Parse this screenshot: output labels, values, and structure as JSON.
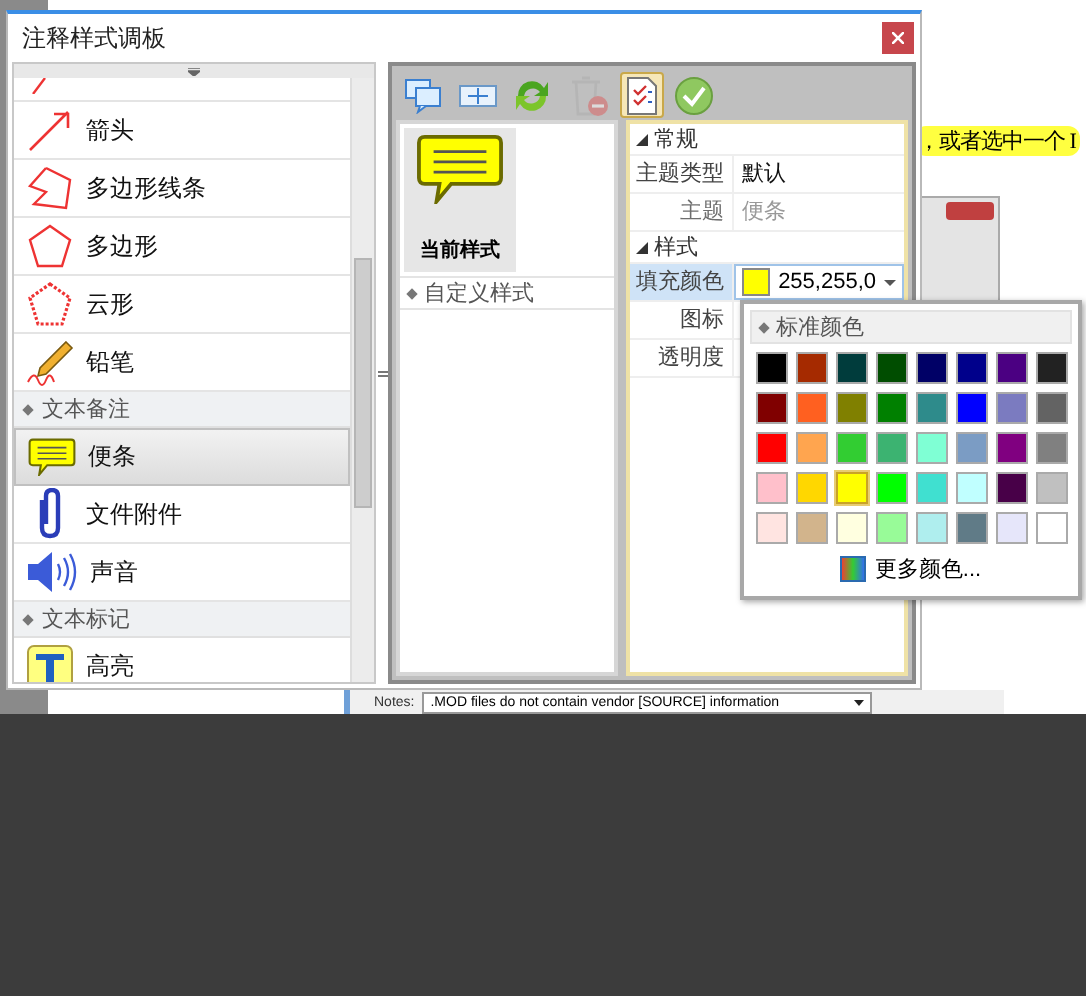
{
  "background_doc": {
    "highlight_text": "，或者选中一个 I",
    "notes_label": "Notes:",
    "notes_value": ".MOD files do not contain vendor [SOURCE] information"
  },
  "window": {
    "title": "注释样式调板"
  },
  "style_list": [
    {
      "kind": "item",
      "selected": false
    },
    {
      "kind": "item",
      "label": "箭头",
      "selected": false
    },
    {
      "kind": "item",
      "label": "多边形线条",
      "selected": false
    },
    {
      "kind": "item",
      "label": "多边形",
      "selected": false
    },
    {
      "kind": "item",
      "label": "云形",
      "selected": false
    },
    {
      "kind": "item",
      "label": "铅笔",
      "selected": false
    },
    {
      "kind": "group",
      "label": "文本备注"
    },
    {
      "kind": "item",
      "label": "便条",
      "selected": true
    },
    {
      "kind": "item",
      "label": "文件附件",
      "selected": false
    },
    {
      "kind": "item",
      "label": "声音",
      "selected": false
    },
    {
      "kind": "group",
      "label": "文本标记"
    },
    {
      "kind": "item",
      "label": "高亮",
      "selected": false
    }
  ],
  "toolbar": [
    {
      "selected": false,
      "disabled": false
    },
    {
      "selected": false,
      "disabled": false
    },
    {
      "selected": false,
      "disabled": false
    },
    {
      "selected": false,
      "disabled": true
    },
    {
      "selected": true,
      "disabled": false
    },
    {
      "selected": false,
      "disabled": false
    }
  ],
  "preview": {
    "current": {
      "label": "当前样式",
      "selected": true
    },
    "custom_group": "自定义样式"
  },
  "properties": [
    {
      "kind": "section",
      "label": "常规",
      "expanded": true
    },
    {
      "kind": "row",
      "label": "主题类型",
      "value": "默认",
      "disabled": false,
      "selected": false
    },
    {
      "kind": "row",
      "label": "主题",
      "value": "便条",
      "disabled": true,
      "selected": false
    },
    {
      "kind": "section",
      "label": "样式",
      "expanded": true
    },
    {
      "kind": "color",
      "label": "填充颜色",
      "value": "255,255,0",
      "color": "#ffff00",
      "selected": true
    },
    {
      "kind": "row",
      "label": "图标",
      "disabled": false,
      "selected": false
    },
    {
      "kind": "row",
      "label": "透明度",
      "disabled": false,
      "selected": false
    }
  ],
  "color_popup": {
    "header": "标准颜色",
    "more": "更多颜色...",
    "swatches": [
      {
        "color": "#000000",
        "selected": false
      },
      {
        "color": "#a52a00",
        "selected": false
      },
      {
        "color": "#003c3c",
        "selected": false
      },
      {
        "color": "#004d00",
        "selected": false
      },
      {
        "color": "#000066",
        "selected": false
      },
      {
        "color": "#00008b",
        "selected": false
      },
      {
        "color": "#4b0082",
        "selected": false
      },
      {
        "color": "#222222",
        "selected": false
      },
      {
        "color": "#800000",
        "selected": false
      },
      {
        "color": "#ff6020",
        "selected": false
      },
      {
        "color": "#808000",
        "selected": false
      },
      {
        "color": "#008000",
        "selected": false
      },
      {
        "color": "#2e8b8b",
        "selected": false
      },
      {
        "color": "#0000ff",
        "selected": false
      },
      {
        "color": "#7b7bc0",
        "selected": false
      },
      {
        "color": "#636363",
        "selected": false
      },
      {
        "color": "#ff0000",
        "selected": false
      },
      {
        "color": "#ffa54f",
        "selected": false
      },
      {
        "color": "#32cd32",
        "selected": false
      },
      {
        "color": "#3cb371",
        "selected": false
      },
      {
        "color": "#7fffd4",
        "selected": false
      },
      {
        "color": "#7b9cc4",
        "selected": false
      },
      {
        "color": "#800080",
        "selected": false
      },
      {
        "color": "#808080",
        "selected": false
      },
      {
        "color": "#ffc0cb",
        "selected": false
      },
      {
        "color": "#ffd700",
        "selected": false
      },
      {
        "color": "#ffff00",
        "selected": true
      },
      {
        "color": "#00ff00",
        "selected": false
      },
      {
        "color": "#40e0d0",
        "selected": false
      },
      {
        "color": "#c0ffff",
        "selected": false
      },
      {
        "color": "#480048",
        "selected": false
      },
      {
        "color": "#c0c0c0",
        "selected": false
      },
      {
        "color": "#ffe4e1",
        "selected": false
      },
      {
        "color": "#d2b48c",
        "selected": false
      },
      {
        "color": "#ffffe0",
        "selected": false
      },
      {
        "color": "#98fb98",
        "selected": false
      },
      {
        "color": "#afeeee",
        "selected": false
      },
      {
        "color": "#607b87",
        "selected": false
      },
      {
        "color": "#e6e6fa",
        "selected": false
      },
      {
        "color": "#ffffff",
        "selected": false
      }
    ]
  }
}
